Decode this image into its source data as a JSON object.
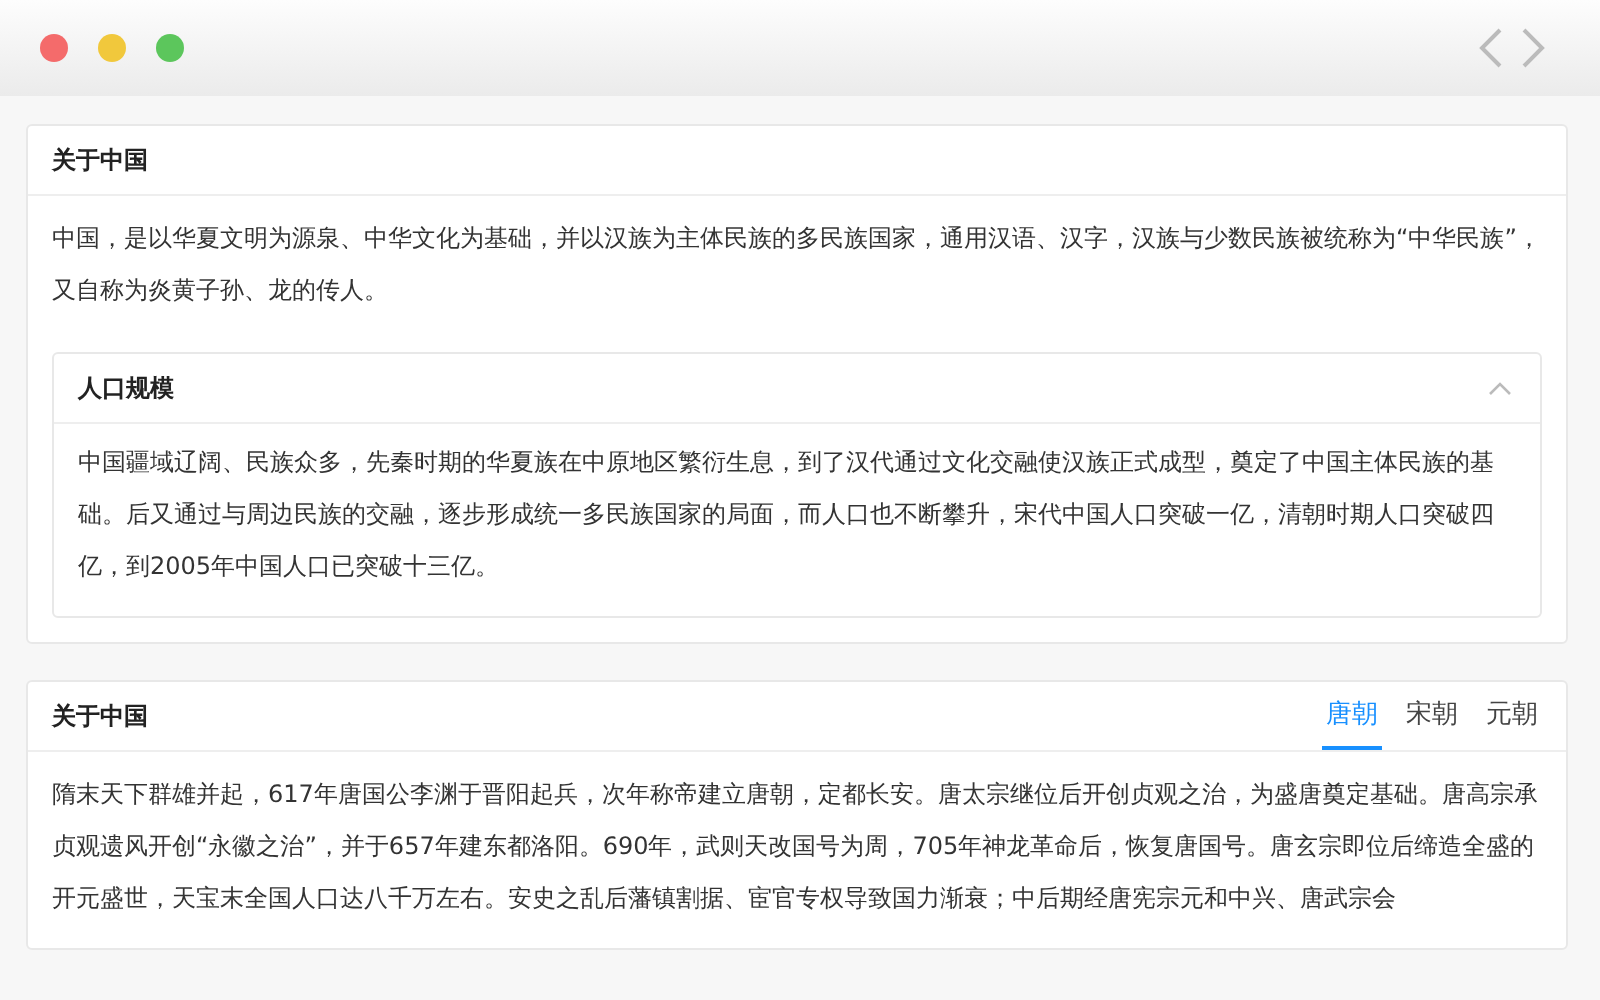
{
  "cards": [
    {
      "title": "关于中国",
      "body": "中国，是以华夏文明为源泉、中华文化为基础，并以汉族为主体民族的多民族国家，通用汉语、汉字，汉族与少数民族被统称为“中华民族”，又自称为炎黄子孙、龙的传人。",
      "collapse": {
        "title": "人口规模",
        "expanded": true,
        "body": "中国疆域辽阔、民族众多，先秦时期的华夏族在中原地区繁衍生息，到了汉代通过文化交融使汉族正式成型，奠定了中国主体民族的基础。后又通过与周边民族的交融，逐步形成统一多民族国家的局面，而人口也不断攀升，宋代中国人口突破一亿，清朝时期人口突破四亿，到2005年中国人口已突破十三亿。"
      }
    },
    {
      "title": "关于中国",
      "tabs": [
        {
          "label": "唐朝",
          "selected": true
        },
        {
          "label": "宋朝",
          "selected": false
        },
        {
          "label": "元朝",
          "selected": false
        }
      ],
      "body": "隋末天下群雄并起，617年唐国公李渊于晋阳起兵，次年称帝建立唐朝，定都长安。唐太宗继位后开创贞观之治，为盛唐奠定基础。唐高宗承贞观遗风开创“永徽之治”，并于657年建东都洛阳。690年，武则天改国号为周，705年神龙革命后，恢复唐国号。唐玄宗即位后缔造全盛的开元盛世，天宝末全国人口达八千万左右。安史之乱后藩镇割据、宦官专权导致国力渐衰；中后期经唐宪宗元和中兴、唐武宗会"
    }
  ]
}
